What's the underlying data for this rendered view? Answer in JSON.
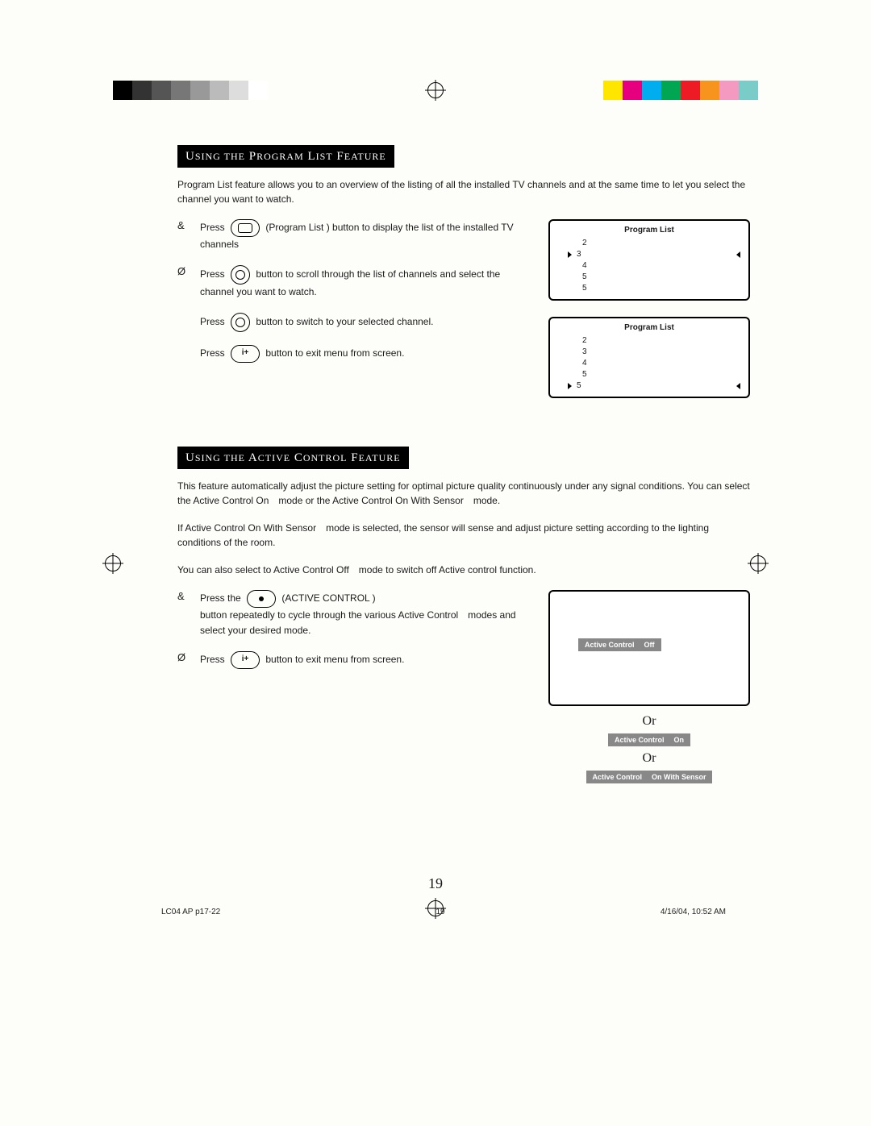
{
  "colorbar": [
    "#000",
    "#333",
    "#555",
    "#777",
    "#999",
    "#bbb",
    "#ddd",
    "#fff",
    "#ffe600",
    "#e6007e",
    "#00aeef",
    "#00a651",
    "#ed1c24",
    "#f7941d",
    "#f49ac1",
    "#7accc8"
  ],
  "section1": {
    "title_parts": [
      "U",
      "SING THE",
      " P",
      "ROGRAM",
      " L",
      "IST",
      " F",
      "EATURE"
    ],
    "intro": "Program List feature allows you to an overview of the listing of all the installed TV channels and at the same time to let you select the channel you want to watch.",
    "steps": [
      {
        "num": "&",
        "text_a": "Press",
        "btn": "inner-box",
        "text_b": "(Program List ) button to display the list of the installed TV channels"
      },
      {
        "num": "Ø",
        "text_a": "Press",
        "btn": "circle",
        "text_b": "button to scroll through the list of channels and select the channel you want to watch."
      },
      {
        "num": "",
        "text_a": "Press",
        "btn": "circle",
        "text_b": "button to switch to your selected channel."
      },
      {
        "num": "",
        "text_a": "Press",
        "btn": "info",
        "text_b": "button to exit menu from screen."
      }
    ],
    "osd1": {
      "title": "Program List",
      "items": [
        "2",
        "3",
        "4",
        "5",
        "5"
      ],
      "selected": 1
    },
    "osd2": {
      "title": "Program List",
      "items": [
        "2",
        "3",
        "4",
        "5",
        "5"
      ],
      "selected": 4
    }
  },
  "section2": {
    "title_parts": [
      "U",
      "SING THE",
      " A",
      "CTIVE",
      " C",
      "ONTROL",
      " F",
      "EATURE"
    ],
    "para1": "This feature automatically adjust the picture setting for optimal picture quality continuously under any signal conditions. You can select the Active Control On mode or the Active Control On With Sensor mode.",
    "para2": "If Active Control On With Sensor mode is selected, the sensor will sense and adjust picture setting according to the lighting conditions of the room.",
    "para3": "You can also select to Active Control Off mode to switch off Active control function.",
    "steps": [
      {
        "num": "&",
        "text_a": "Press the",
        "btn": "dot",
        "text_b": "(ACTIVE CONTROL )",
        "text_c": "button repeatedly to cycle through the various Active Control modes and select your desired mode."
      },
      {
        "num": "Ø",
        "text_a": "Press",
        "btn": "info",
        "text_b": "button to exit menu from screen."
      }
    ],
    "tv_pill": {
      "label": "Active Control",
      "value": "Off"
    },
    "or": "Or",
    "pill2": {
      "label": "Active Control",
      "value": "On"
    },
    "pill3": {
      "label": "Active Control",
      "value": "On With Sensor"
    }
  },
  "page_number": "19",
  "footer": {
    "file": "LC04 AP p17-22",
    "pg": "19",
    "date": "4/16/04, 10:52 AM"
  }
}
